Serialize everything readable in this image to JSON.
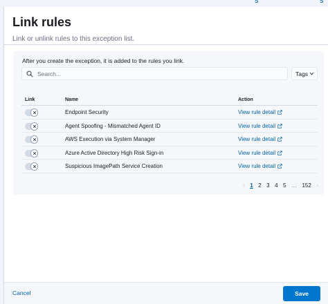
{
  "background": {
    "top_link_1": "s",
    "top_link_2": "s"
  },
  "flyout": {
    "title": "Link rules",
    "subtitle": "Link or unlink rules to this exception list."
  },
  "panel": {
    "help_text": "After you create the exception, it is added to the rules you link.",
    "search": {
      "placeholder": "Search...",
      "value": ""
    },
    "tags_label": "Tags"
  },
  "table": {
    "columns": {
      "link": "Link",
      "name": "Name",
      "action": "Action"
    },
    "rows": [
      {
        "name": "Endpoint Security",
        "action": "View rule detail",
        "linked": false
      },
      {
        "name": "Agent Spoofing - Mismatched Agent ID",
        "action": "View rule detail",
        "linked": false
      },
      {
        "name": "AWS Execution via System Manager",
        "action": "View rule detail",
        "linked": false
      },
      {
        "name": "Azure Active Directory High Risk Sign-in",
        "action": "View rule detail",
        "linked": false
      },
      {
        "name": "Suspicious ImagePath Service Creation",
        "action": "View rule detail",
        "linked": false
      }
    ]
  },
  "pagination": {
    "prev": "‹",
    "pages": [
      "1",
      "2",
      "3",
      "4",
      "5"
    ],
    "ellipsis": "…",
    "last": "152",
    "next": "›",
    "current": "1"
  },
  "footer": {
    "cancel_label": "Cancel",
    "save_label": "Save"
  },
  "colors": {
    "accent": "#0077cc",
    "link": "#0061a6",
    "panel_bg": "#f5f7fa"
  }
}
